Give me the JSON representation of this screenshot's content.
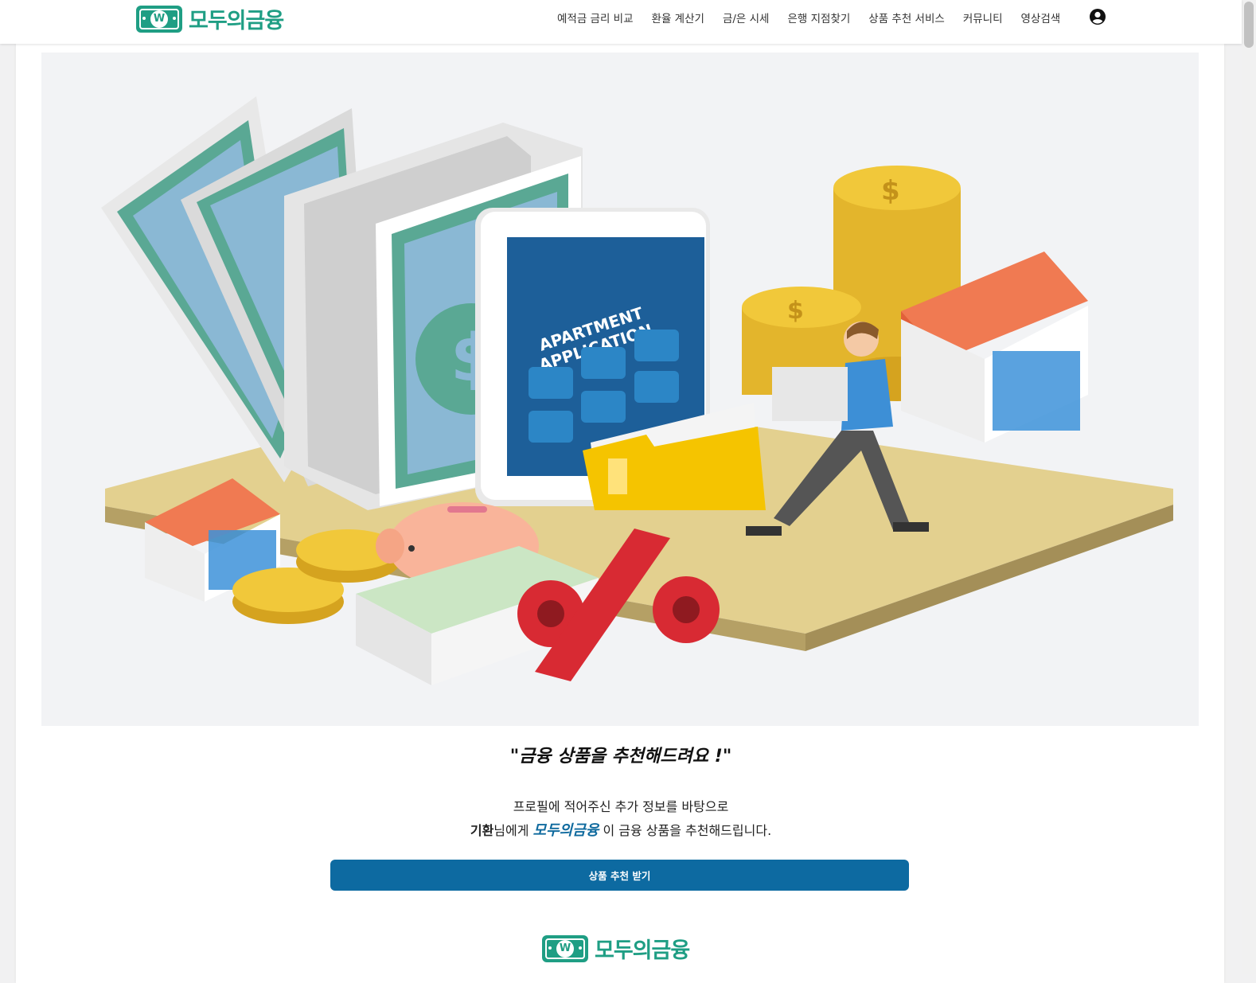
{
  "brand": {
    "name": "모두의금융",
    "badge_letter": "W",
    "color": "#1f9e84"
  },
  "nav": {
    "items": [
      "예적금 금리 비교",
      "환율 계산기",
      "금/은 시세",
      "은행 지점찾기",
      "상품 추천 서비스",
      "커뮤니티",
      "영상검색"
    ],
    "user_icon": "user-circle-icon"
  },
  "hero": {
    "image_description_icon": "finance-illustration",
    "tablet_text_line1": "APARTMENT",
    "tablet_text_line2": "APPLICATION"
  },
  "content": {
    "quote": "\"금융 상품을 추천해드려요 !\"",
    "desc_line1": "프로필에 적어주신 추가 정보를 바탕으로",
    "user_name": "기환",
    "desc_line2_mid": "님에게 ",
    "desc_line2_brand": "모두의금융",
    "desc_line2_end": " 이 금융 상품을 추천해드립니다.",
    "cta_label": "상품 추천 받기"
  },
  "colors": {
    "accent": "#0d6aa1",
    "brand": "#1f9e84"
  }
}
